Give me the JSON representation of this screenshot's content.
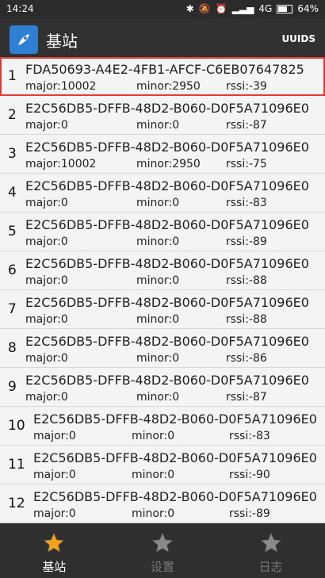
{
  "status_bar": {
    "time": "14:24",
    "network": "4G",
    "battery": "64%",
    "battery_level": 0.64
  },
  "app_bar": {
    "title": "基站",
    "action": "UUIDS",
    "icon": "rocket-icon"
  },
  "beacons": [
    {
      "index": "1",
      "uuid": "FDA50693-A4E2-4FB1-AFCF-C6EB07647825",
      "major": "major:10002",
      "minor": "minor:2950",
      "rssi": "rssi:-39"
    },
    {
      "index": "2",
      "uuid": "E2C56DB5-DFFB-48D2-B060-D0F5A71096E0",
      "major": "major:0",
      "minor": "minor:0",
      "rssi": "rssi:-87"
    },
    {
      "index": "3",
      "uuid": "E2C56DB5-DFFB-48D2-B060-D0F5A71096E0",
      "major": "major:10002",
      "minor": "minor:2950",
      "rssi": "rssi:-75"
    },
    {
      "index": "4",
      "uuid": "E2C56DB5-DFFB-48D2-B060-D0F5A71096E0",
      "major": "major:0",
      "minor": "minor:0",
      "rssi": "rssi:-83"
    },
    {
      "index": "5",
      "uuid": "E2C56DB5-DFFB-48D2-B060-D0F5A71096E0",
      "major": "major:0",
      "minor": "minor:0",
      "rssi": "rssi:-89"
    },
    {
      "index": "6",
      "uuid": "E2C56DB5-DFFB-48D2-B060-D0F5A71096E0",
      "major": "major:0",
      "minor": "minor:0",
      "rssi": "rssi:-88"
    },
    {
      "index": "7",
      "uuid": "E2C56DB5-DFFB-48D2-B060-D0F5A71096E0",
      "major": "major:0",
      "minor": "minor:0",
      "rssi": "rssi:-88"
    },
    {
      "index": "8",
      "uuid": "E2C56DB5-DFFB-48D2-B060-D0F5A71096E0",
      "major": "major:0",
      "minor": "minor:0",
      "rssi": "rssi:-86"
    },
    {
      "index": "9",
      "uuid": "E2C56DB5-DFFB-48D2-B060-D0F5A71096E0",
      "major": "major:0",
      "minor": "minor:0",
      "rssi": "rssi:-87"
    },
    {
      "index": "10",
      "uuid": "E2C56DB5-DFFB-48D2-B060-D0F5A71096E0",
      "major": "major:0",
      "minor": "minor:0",
      "rssi": "rssi:-83"
    },
    {
      "index": "11",
      "uuid": "E2C56DB5-DFFB-48D2-B060-D0F5A71096E0",
      "major": "major:0",
      "minor": "minor:0",
      "rssi": "rssi:-90"
    },
    {
      "index": "12",
      "uuid": "E2C56DB5-DFFB-48D2-B060-D0F5A71096E0",
      "major": "major:0",
      "minor": "minor:0",
      "rssi": "rssi:-89"
    }
  ],
  "bottom_nav": [
    {
      "label": "基站",
      "icon": "star-icon",
      "active": true
    },
    {
      "label": "设置",
      "icon": "star-icon",
      "active": false
    },
    {
      "label": "日志",
      "icon": "star-icon",
      "active": false
    }
  ],
  "colors": {
    "highlight": "#e53935",
    "active_star": "#f4a21e",
    "inactive_star": "#8a8a8a",
    "app_icon": "#2f7fd4"
  }
}
